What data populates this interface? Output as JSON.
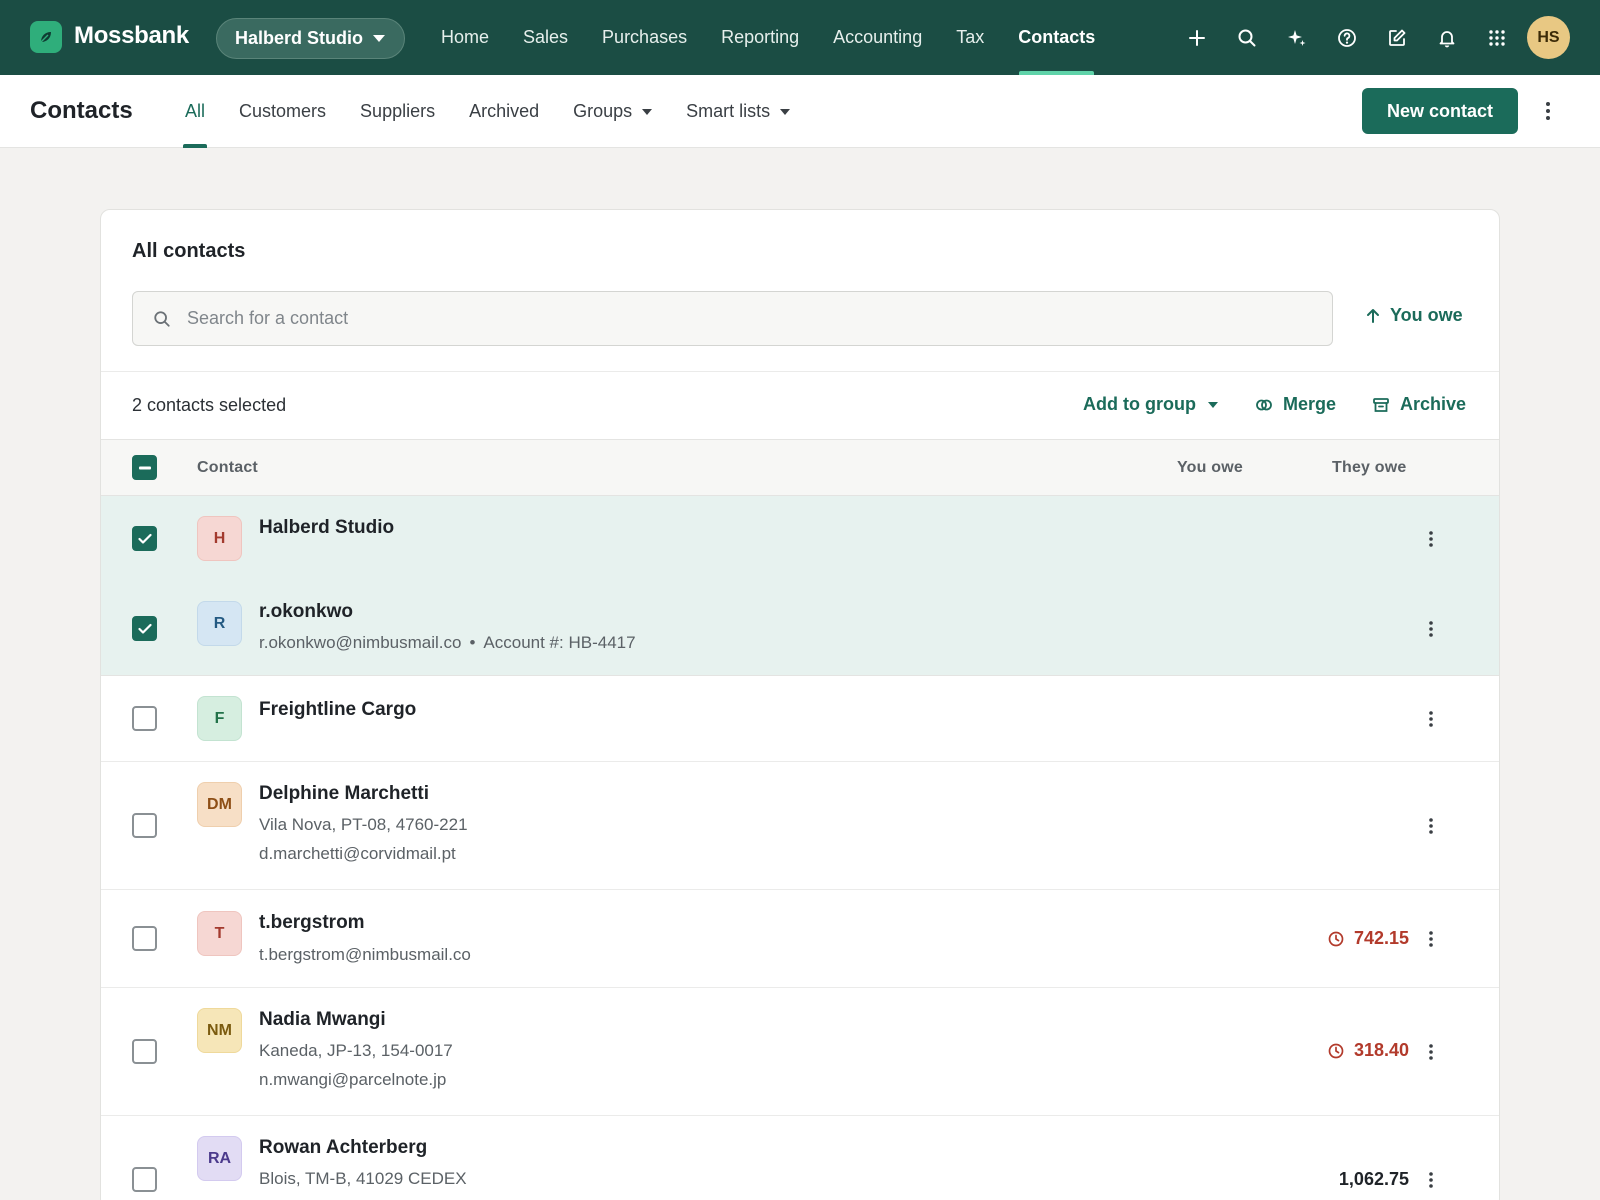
{
  "app": {
    "brand": "Mossbank",
    "org": "Halberd Studio",
    "user_initials": "HS"
  },
  "nav": [
    {
      "label": "Home"
    },
    {
      "label": "Sales"
    },
    {
      "label": "Purchases"
    },
    {
      "label": "Reporting"
    },
    {
      "label": "Accounting"
    },
    {
      "label": "Tax"
    },
    {
      "label": "Contacts"
    }
  ],
  "top_icons": [
    "plus-icon",
    "search-icon",
    "sparkle-icon",
    "help-icon",
    "compose-icon",
    "bell-icon",
    "apps-grid-icon"
  ],
  "page": {
    "title": "Contacts",
    "new_contact": "New contact"
  },
  "subtabs": [
    {
      "label": "All"
    },
    {
      "label": "Customers"
    },
    {
      "label": "Suppliers"
    },
    {
      "label": "Archived"
    },
    {
      "label": "Groups"
    },
    {
      "label": "Smart lists"
    }
  ],
  "card": {
    "title": "All contacts",
    "search_placeholder": "Search for a contact",
    "sort_label": "You owe",
    "selected_count": "2 contacts selected",
    "add_to_group": "Add to group",
    "merge": "Merge",
    "archive": "Archive",
    "columns": {
      "contact": "Contact",
      "you_owe": "You owe",
      "they_owe": "They owe"
    }
  },
  "contacts": [
    {
      "initials": "H",
      "name": "Halberd Studio",
      "checked": true
    },
    {
      "initials": "R",
      "name": "r.okonkwo",
      "email": "r.okonkwo@nimbusmail.co",
      "dot": "•",
      "account": "Account #: HB-4417",
      "checked": true
    },
    {
      "initials": "F",
      "name": "Freightline Cargo",
      "checked": false
    },
    {
      "initials": "DM",
      "name": "Delphine Marchetti",
      "address": "Vila Nova, PT-08, 4760-221",
      "email": "d.marchetti@corvidmail.pt",
      "checked": false
    },
    {
      "initials": "T",
      "name": "t.bergstrom",
      "email": "t.bergstrom@nimbusmail.co",
      "they_owe": "742.15",
      "overdue": true,
      "checked": false
    },
    {
      "initials": "NM",
      "name": "Nadia Mwangi",
      "address": "Kaneda, JP-13, 154-0017",
      "email": "n.mwangi@parcelnote.jp",
      "they_owe": "318.40",
      "overdue": true,
      "checked": false
    },
    {
      "initials": "RA",
      "name": "Rowan Achterberg",
      "address": "Blois, TM-B, 41029 CEDEX",
      "they_owe": "1,062.75",
      "overdue": false,
      "checked": false
    }
  ],
  "colors": {
    "brand_dark": "#1b4d44",
    "accent": "#1b6b5a",
    "overdue": "#b23a2b",
    "selected_row": "#e7f2ef"
  }
}
